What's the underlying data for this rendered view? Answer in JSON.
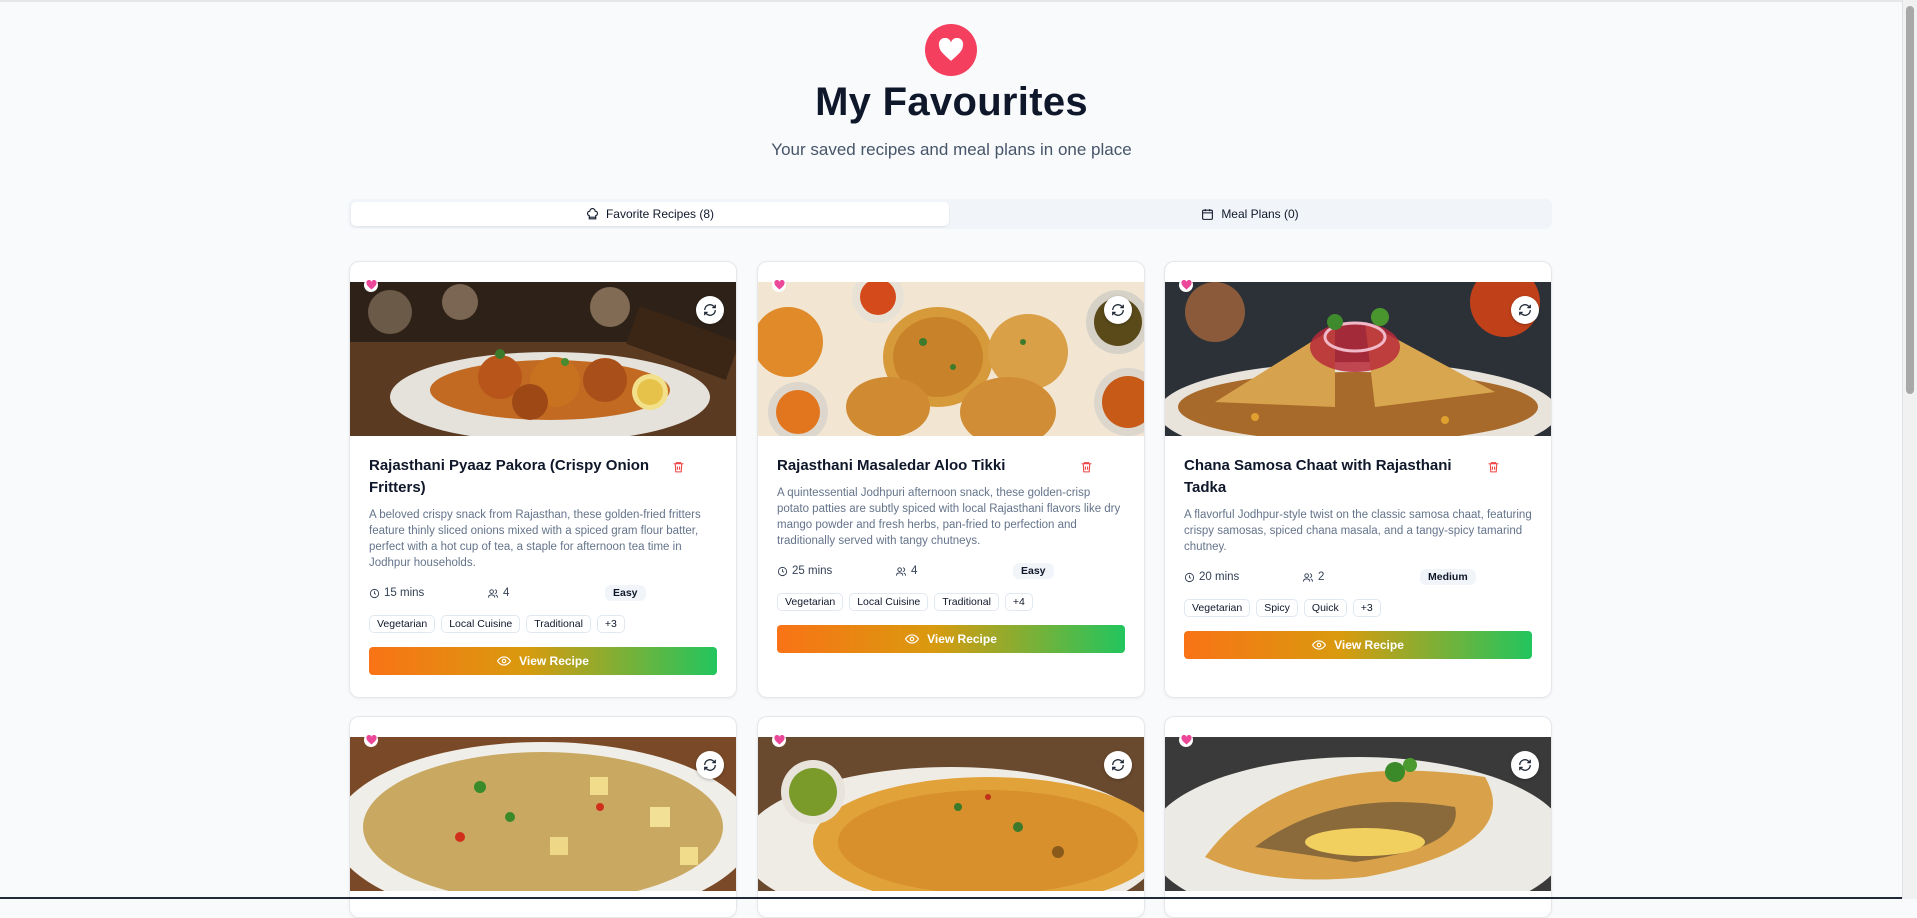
{
  "page": {
    "title": "My Favourites",
    "subtitle": "Your saved recipes and meal plans in one place"
  },
  "tabs": [
    {
      "label": "Favorite Recipes (8)",
      "icon": "chef-hat-icon",
      "active": true
    },
    {
      "label": "Meal Plans (0)",
      "icon": "calendar-icon",
      "active": false
    }
  ],
  "colors": {
    "accent": "#f43f5e",
    "gradient_start": "#f97316",
    "gradient_end": "#22c55e",
    "delete": "#ef4444"
  },
  "recipes": [
    {
      "title": "Rajasthani Pyaaz Pakora (Crispy Onion Fritters)",
      "description": "A beloved crispy snack from Rajasthan, these golden-fried fritters feature thinly sliced onions mixed with a spiced gram flour batter, perfect with a hot cup of tea, a staple for afternoon tea time in Jodhpur households.",
      "time": "15 mins",
      "servings": "4",
      "difficulty": "Easy",
      "tags": [
        "Vegetarian",
        "Local Cuisine",
        "Traditional",
        "+3"
      ],
      "button": "View Recipe"
    },
    {
      "title": "Rajasthani Masaledar Aloo Tikki",
      "description": "A quintessential Jodhpuri afternoon snack, these golden-crisp potato patties are subtly spiced with local Rajasthani flavors like dry mango powder and fresh herbs, pan-fried to perfection and traditionally served with tangy chutneys.",
      "time": "25 mins",
      "servings": "4",
      "difficulty": "Easy",
      "tags": [
        "Vegetarian",
        "Local Cuisine",
        "Traditional",
        "+4"
      ],
      "button": "View Recipe"
    },
    {
      "title": "Chana Samosa Chaat with Rajasthani Tadka",
      "description": "A flavorful Jodhpur-style twist on the classic samosa chaat, featuring crispy samosas, spiced chana masala, and a tangy-spicy tamarind chutney.",
      "time": "20 mins",
      "servings": "2",
      "difficulty": "Medium",
      "tags": [
        "Vegetarian",
        "Spicy",
        "Quick",
        "+3"
      ],
      "button": "View Recipe"
    }
  ]
}
